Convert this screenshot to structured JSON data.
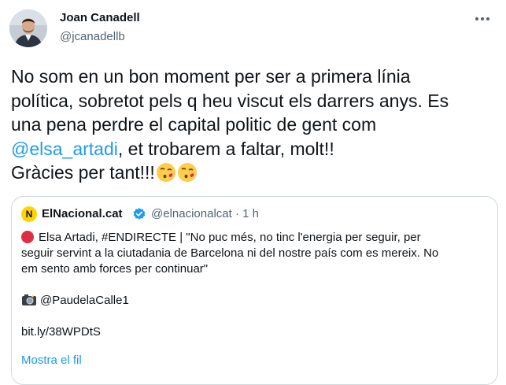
{
  "author": {
    "name": "Joan Canadell",
    "handle": "@jcanadellb"
  },
  "tweet": {
    "line1": "No som en un bon moment per ser a primera línia",
    "line2": "política, sobretot pels q heu viscut els darrers anys. Es",
    "line3": "una pena perdre el capital politic de gent com",
    "mention": "@elsa_artadi",
    "line4_rest": ", et trobarem a faltar, molt!!",
    "line5": "Gràcies per tant!!!",
    "emojis": [
      "kissing-face-heart-emoji",
      "kissing-face-heart-emoji"
    ]
  },
  "quoted": {
    "logo_letter": "N",
    "name": "ElNacional.cat",
    "handle_time": "@elnacionalcat · 1 h",
    "body_line1": "Elsa Artadi, #ENDIRECTE | \"No puc més, no tinc l'energia per seguir, per",
    "body_line2": "seguir servint a la ciutadania de Barcelona ni del nostre país com es  mereix. No",
    "body_line3": "em sento amb forces per continuar\"",
    "photo_credit": "@PaudelaCalle1",
    "link": "bit.ly/38WPDtS",
    "show_more": "Mostra el fil"
  },
  "colors": {
    "accent": "#1d9bf0",
    "text": "#0f1419",
    "secondary": "#536471",
    "border": "#cfd9de"
  }
}
